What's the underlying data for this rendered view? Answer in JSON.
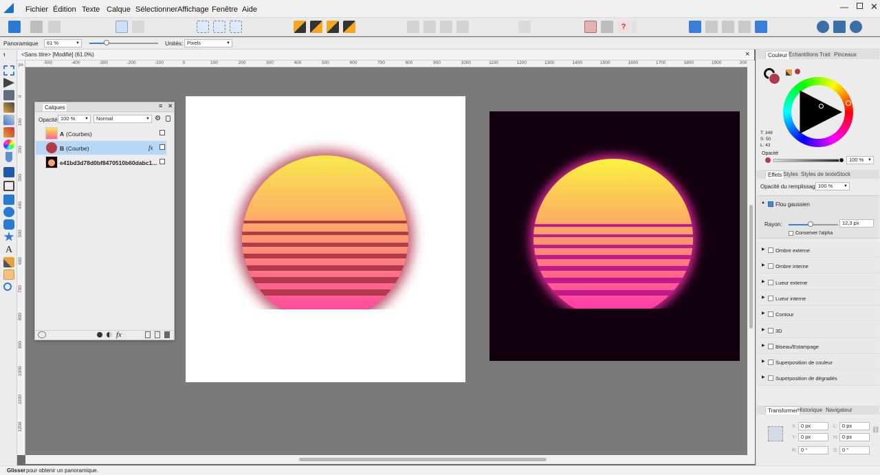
{
  "menu": [
    "Fichier",
    "Édition",
    "Texte",
    "Calque",
    "Sélectionner",
    "Affichage",
    "Fenêtre",
    "Aide"
  ],
  "context": {
    "tool_label": "Panoramique",
    "zoom": "61 %",
    "units_label": "Unités:",
    "units_value": "Pixels"
  },
  "document": {
    "tab_title": "<Sans titre> [Modifié] (61.0%)",
    "close": "×"
  },
  "ruler": {
    "h_ticks": [
      "-500",
      "-400",
      "-300",
      "-200",
      "-100",
      "0",
      "100",
      "200",
      "300",
      "400",
      "500",
      "600",
      "700",
      "800",
      "900",
      "1000",
      "1100",
      "1200",
      "1300",
      "1400",
      "1500",
      "1600",
      "1700",
      "1800",
      "1900",
      "200"
    ],
    "v_ticks": [
      "0",
      "100",
      "200",
      "300",
      "400",
      "500",
      "600",
      "700",
      "800",
      "900",
      "1000",
      "1100",
      "1200"
    ],
    "unit": "px"
  },
  "layers_panel": {
    "title": "Calques",
    "opacity_label": "Opacité:",
    "opacity_value": "100 %",
    "blend_mode": "Normal",
    "layers": [
      {
        "name": "A",
        "type": "(Courbes)",
        "selected": false,
        "fx": false,
        "visible": true
      },
      {
        "name": "B",
        "type": "(Courbe)",
        "selected": true,
        "fx": true,
        "visible": true
      },
      {
        "name": "e41bd3d78d0bf8470510b60dabc1...",
        "type": "",
        "selected": false,
        "fx": false,
        "visible": true
      }
    ],
    "fx_symbol": "fx"
  },
  "color_panel": {
    "tabs": [
      "Couleur",
      "Échantillons",
      "Trait",
      "Pinceaux"
    ],
    "h_label": "T: 348",
    "s_label": "S: 50",
    "l_label": "L: 43",
    "opacity_label": "Opacité",
    "opacity_value": "100 %",
    "fill_color": "#b13a4a"
  },
  "effects_panel": {
    "tabs": [
      "Effets",
      "Styles",
      "Styles de texte",
      "Stock"
    ],
    "fill_opacity_label": "Opacité du remplissage:",
    "fill_opacity_value": "100 %",
    "gaussian_blur": {
      "label": "Flou gaussien",
      "enabled": true,
      "radius_label": "Rayon:",
      "radius_value": "12,3 px",
      "preserve_alpha_label": "Conserver l'alpha",
      "slider_fraction": 0.45
    },
    "effects": [
      "Ombre externe",
      "Ombre interne",
      "Lueur externe",
      "Lueur interne",
      "Contour",
      "3D",
      "Biseau/Estampage",
      "Superposition de couleur",
      "Superposition de dégradés"
    ]
  },
  "transform_panel": {
    "tabs": [
      "Transformer",
      "Historique",
      "Navigateur"
    ],
    "x_label": "X:",
    "x_value": "0 px",
    "y_label": "Y:",
    "y_value": "0 px",
    "w_label": "L:",
    "w_value": "0 px",
    "h_label": "H:",
    "h_value": "0 px",
    "r_label": "R:",
    "r_value": "0 °",
    "s_label": "S:",
    "s_value": "0 °"
  },
  "status": {
    "bold": "Glisser",
    "text": " pour obtenir un panoramique."
  },
  "colors": {
    "sun_top": "#f9e94e",
    "sun_mid": "#fca26a",
    "sun_bottom": "#ff3fa6",
    "dark_bg": "#13000f",
    "accent": "#3b7ed8"
  }
}
